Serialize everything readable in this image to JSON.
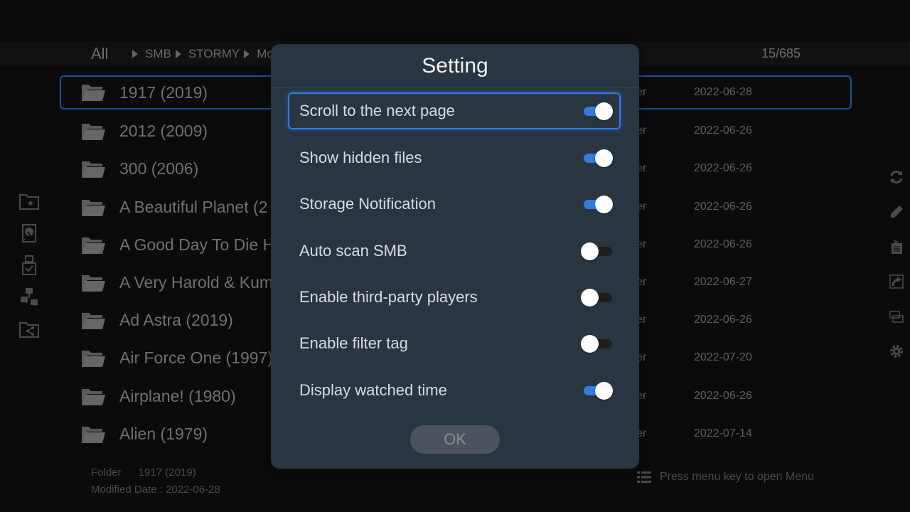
{
  "breadcrumb": {
    "root": "All",
    "items": [
      "SMB",
      "STORMY",
      "Mo"
    ]
  },
  "item_count": "15/685",
  "files": [
    {
      "name": "1917 (2019)",
      "type": "Folder",
      "date": "2022-06-28",
      "selected": true
    },
    {
      "name": "2012 (2009)",
      "type": "Folder",
      "date": "2022-06-26"
    },
    {
      "name": "300 (2006)",
      "type": "Folder",
      "date": "2022-06-26"
    },
    {
      "name": "A Beautiful Planet (2",
      "type": "Folder",
      "date": "2022-06-26"
    },
    {
      "name": "A Good Day To Die H",
      "type": "Folder",
      "date": "2022-06-26"
    },
    {
      "name": "A Very Harold & Kum",
      "type": "Folder",
      "date": "2022-06-27"
    },
    {
      "name": "Ad Astra (2019)",
      "type": "Folder",
      "date": "2022-06-26"
    },
    {
      "name": "Air Force One (1997)",
      "type": "Folder",
      "date": "2022-07-20"
    },
    {
      "name": "Airplane! (1980)",
      "type": "Folder",
      "date": "2022-06-26"
    },
    {
      "name": "Alien (1979)",
      "type": "Folder",
      "date": "2022-07-14"
    }
  ],
  "left_nav_icons": [
    "favorites-folder-icon",
    "local-disk-icon",
    "usb-drive-icon",
    "network-icon",
    "shared-folder-icon"
  ],
  "right_action_icons": [
    "refresh-icon",
    "rename-icon",
    "new-file-icon",
    "shortcut-icon",
    "copy-icon",
    "settings-icon"
  ],
  "info": {
    "type_label": "Folder",
    "type_value": "1917 (2019)",
    "date_label": "Modified Date :",
    "date_value": "2022-06-28"
  },
  "menu_hint": "Press menu key to open Menu",
  "dialog": {
    "title": "Setting",
    "options": [
      {
        "label": "Scroll to the next page",
        "enabled": true,
        "focused": true
      },
      {
        "label": "Show hidden files",
        "enabled": true
      },
      {
        "label": "Storage Notification",
        "enabled": true
      },
      {
        "label": "Auto scan SMB",
        "enabled": false
      },
      {
        "label": "Enable third-party players",
        "enabled": false
      },
      {
        "label": "Enable filter tag",
        "enabled": false
      },
      {
        "label": "Display watched time",
        "enabled": true
      }
    ],
    "ok_label": "OK"
  },
  "colors": {
    "accent": "#2f7de0",
    "dialog_bg": "#2a3542",
    "selection_border": "#1a4fa0"
  }
}
